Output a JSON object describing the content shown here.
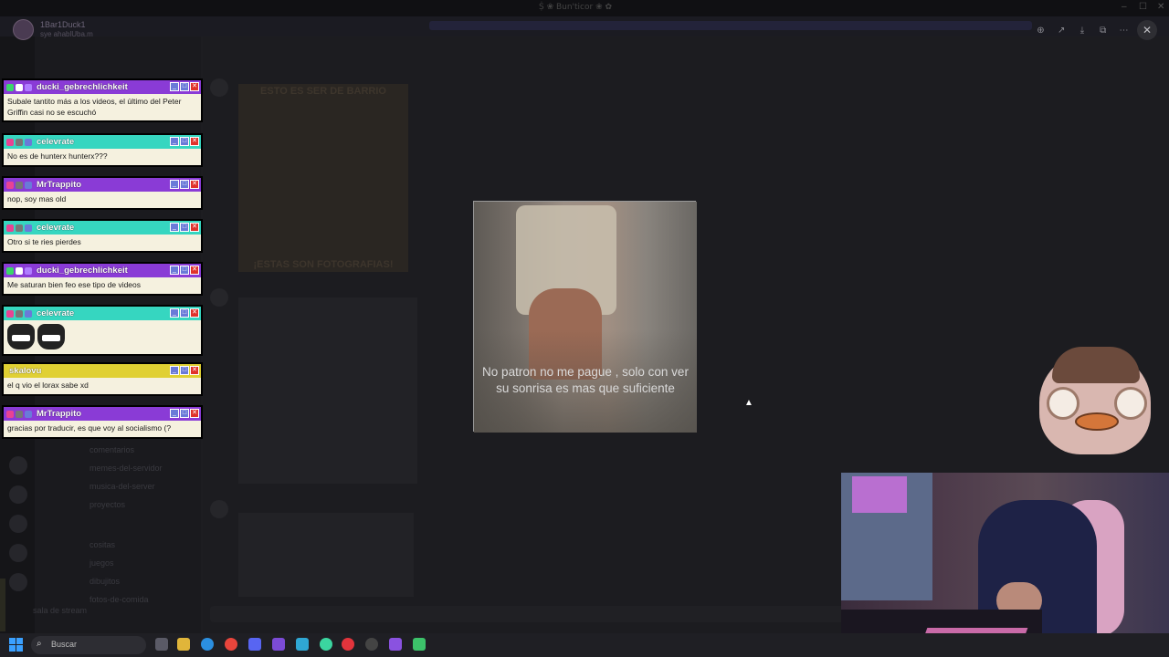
{
  "window": {
    "title": "Ṩ ❀ Bun'ticor ❀ ✿"
  },
  "profile": {
    "name": "1Bar1Duck1",
    "status": "sye ahablUba.m"
  },
  "background": {
    "channels": [
      "comentarios",
      "memes-del-servidor",
      "musica-del-server",
      "proyectos",
      "cositas",
      "juegos",
      "dibujitos",
      "fotos-de-comida"
    ],
    "meme_top": "ESTO ES SER DE BARRIO",
    "meme_bottom": "¡ESTAS SON FOTOGRAFIAS!",
    "voice_label": "sala de stream"
  },
  "chat": [
    {
      "color": "#8a3bd6",
      "user": "ducki_gebrechlichkeit",
      "text": "Subale tantito más a los videos, el último del Peter Griffin casi no se escuchó"
    },
    {
      "color": "#36d6c0",
      "user": "celevrate",
      "text": "No es de hunterx hunterx???"
    },
    {
      "color": "#8a3bd6",
      "user": "MrTrappito",
      "text": "nop, soy mas old"
    },
    {
      "color": "#36d6c0",
      "user": "celevrate",
      "text": "Otro si te ries pierdes"
    },
    {
      "color": "#8a3bd6",
      "user": "ducki_gebrechlichkeit",
      "text": "Me saturan bien feo ese tipo de videos"
    },
    {
      "color": "#36d6c0",
      "user": "celevrate",
      "text": ""
    },
    {
      "color": "#e0d033",
      "user": "skalovu",
      "text": "el q vio el lorax sabe xd"
    },
    {
      "color": "#8a3bd6",
      "user": "MrTrappito",
      "text": "gracias por traducir, es que voy al socialismo (?"
    }
  ],
  "modal": {
    "caption": "No patron no me pague , solo con ver su sonrisa es mas que suficiente"
  },
  "viewer_controls": [
    "zoom-in-icon",
    "share-icon",
    "download-icon",
    "open-external-icon",
    "more-icon"
  ],
  "taskbar": {
    "search_placeholder": "Buscar"
  }
}
